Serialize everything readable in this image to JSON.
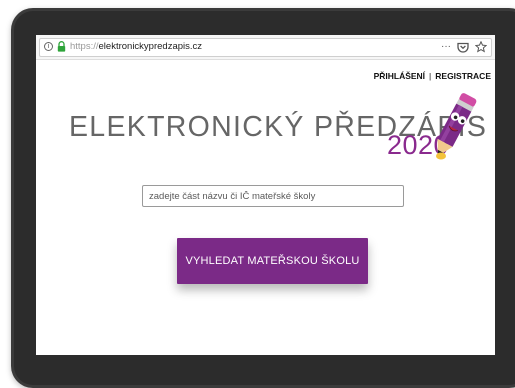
{
  "browser": {
    "url_protocol": "https://",
    "url_host": "elektronickypredzapis.cz",
    "actions": {
      "more": "···",
      "pocket": "pocket-icon",
      "bookmark": "star-icon"
    }
  },
  "header": {
    "login_label": "PŘIHLÁŠENÍ",
    "separator": "|",
    "register_label": "REGISTRACE"
  },
  "logo": {
    "title": "ELEKTRONICKÝ PŘEDZÁPIS",
    "year": "2020",
    "mascot": "pencil-mascot"
  },
  "search": {
    "placeholder": "zadejte část názvu či IČ mateřské školy",
    "value": ""
  },
  "search_button": {
    "label": "VYHLEDAT MATEŘSKOU ŠKOLU"
  },
  "colors": {
    "brand_purple": "#7b2a87",
    "year_purple": "#8a2a8e",
    "title_gray": "#666666",
    "device": "#3b3b3b"
  }
}
